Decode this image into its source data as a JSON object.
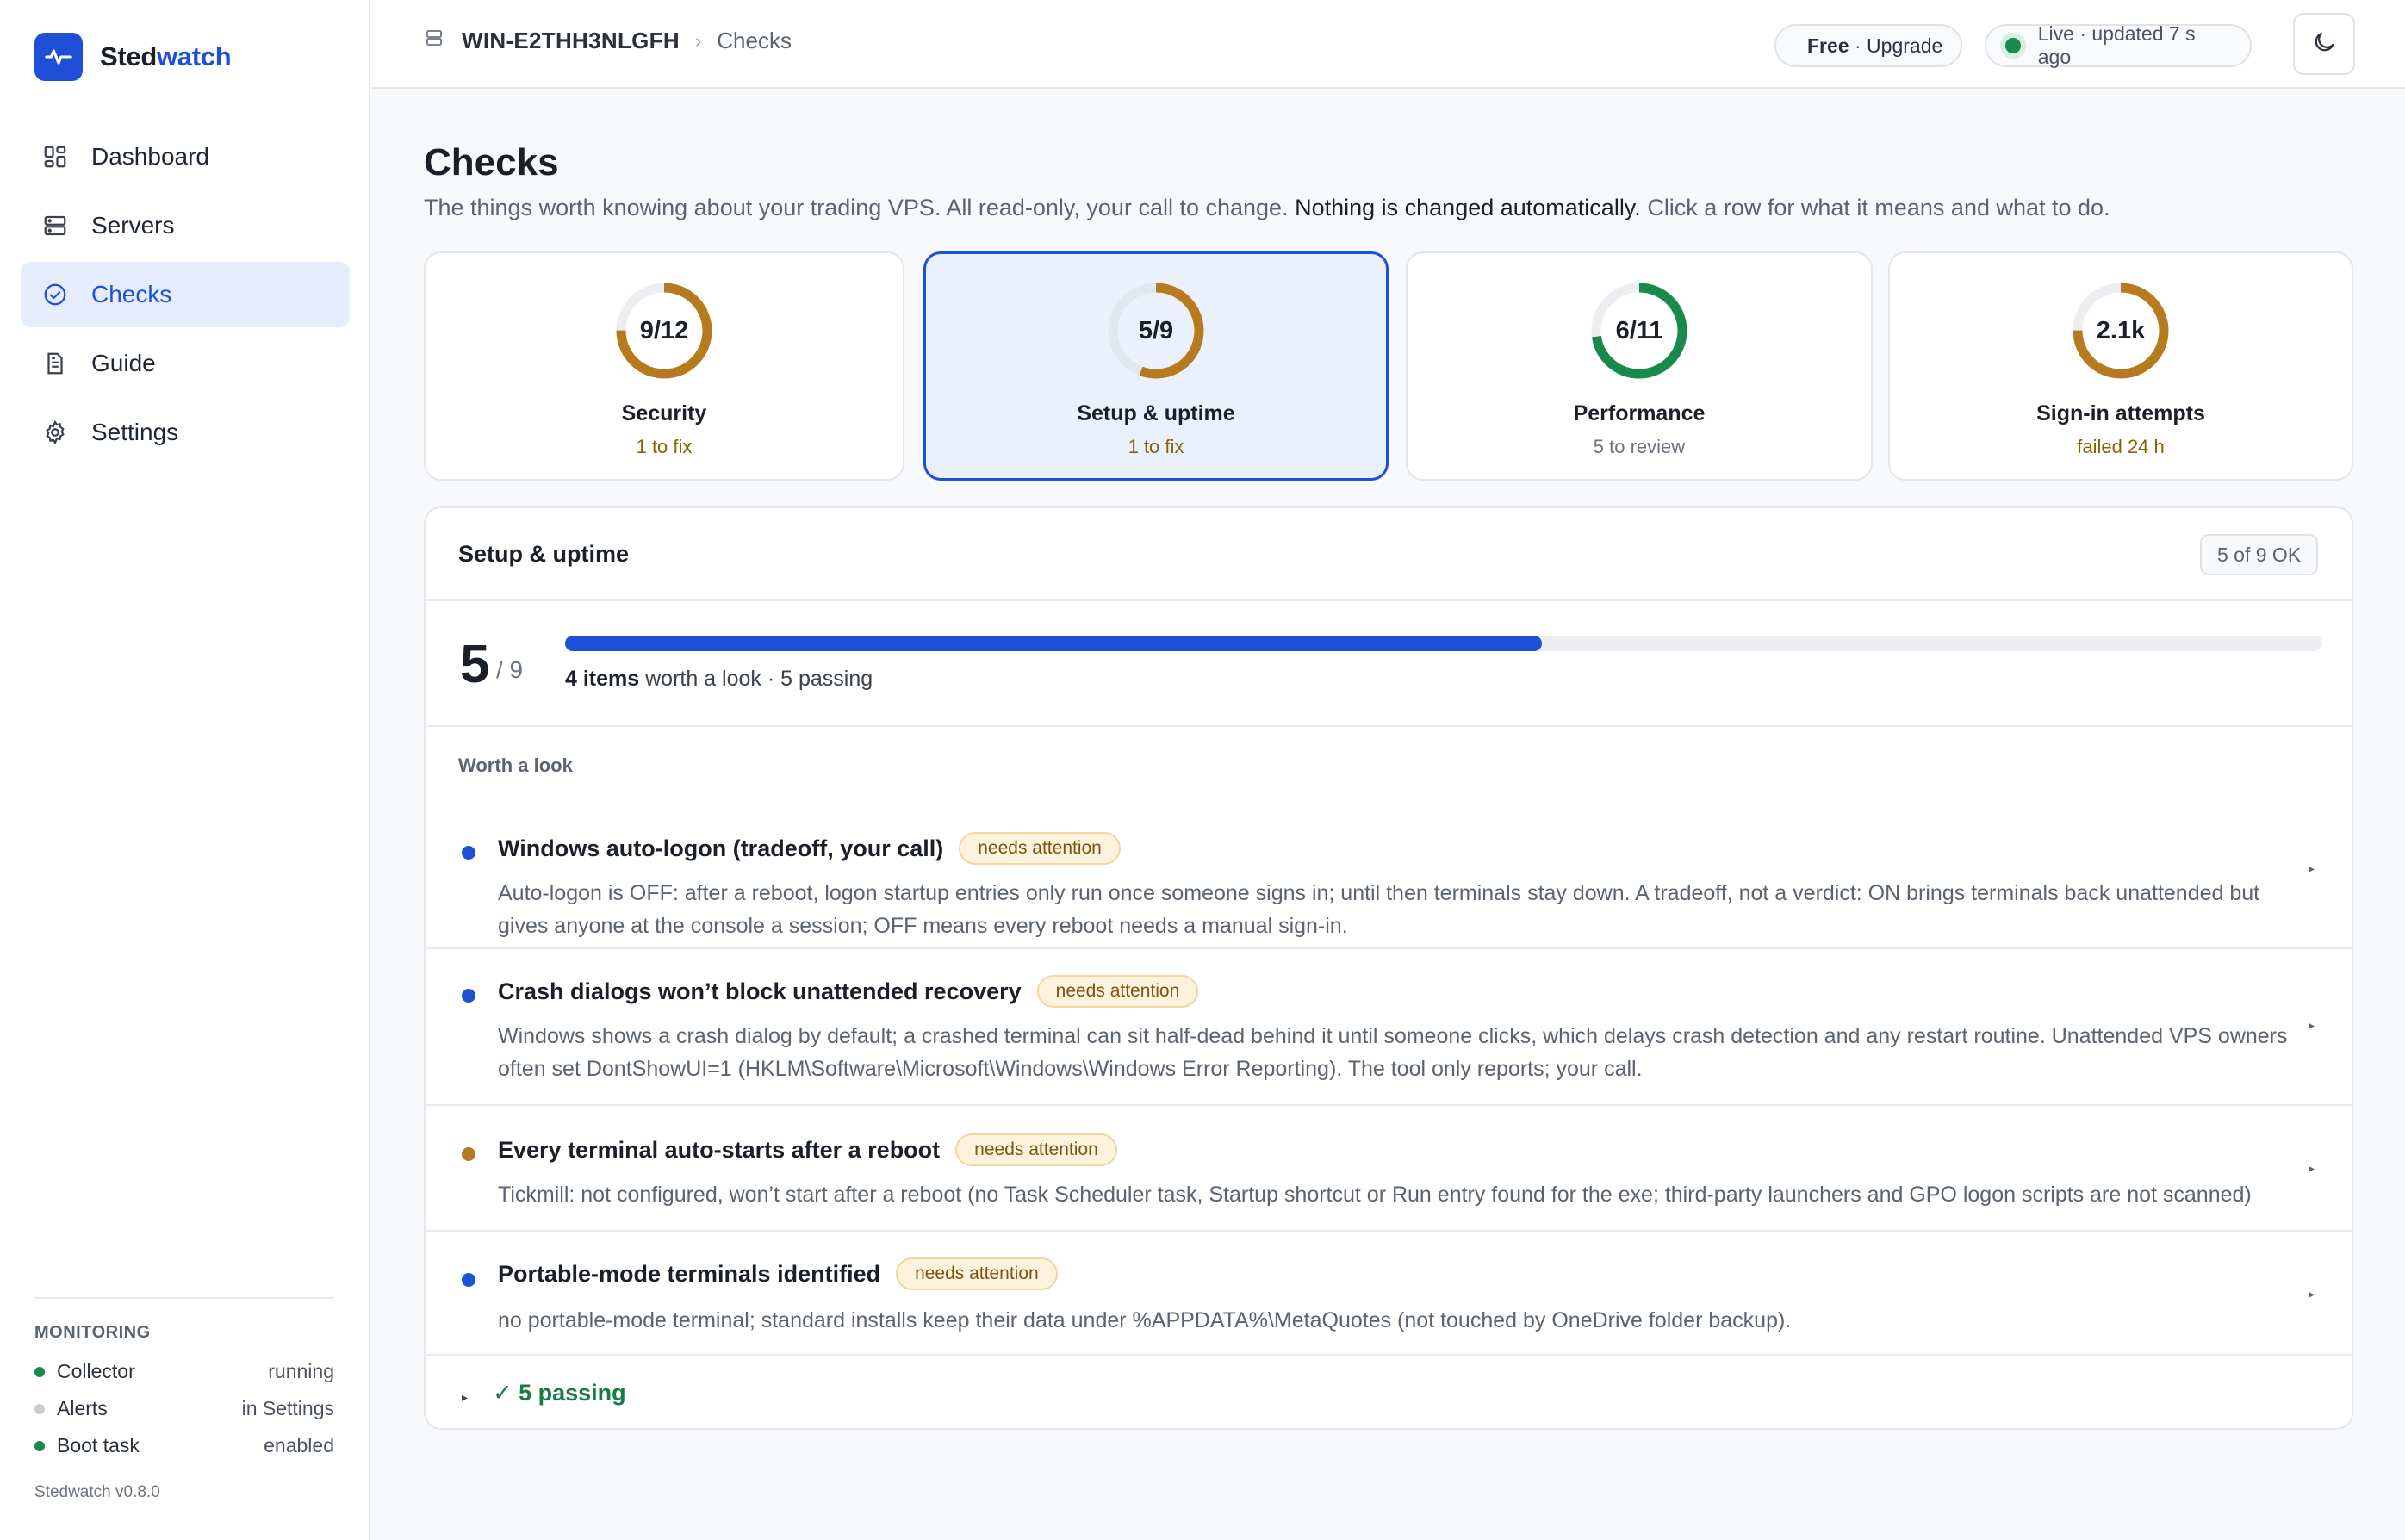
{
  "brand": {
    "name_prefix": "Sted",
    "name_suffix": "watch"
  },
  "sidebar": {
    "items": [
      {
        "label": "Dashboard",
        "icon": "dashboard-icon"
      },
      {
        "label": "Servers",
        "icon": "servers-icon"
      },
      {
        "label": "Checks",
        "icon": "checks-icon",
        "active": true
      },
      {
        "label": "Guide",
        "icon": "guide-icon"
      },
      {
        "label": "Settings",
        "icon": "gear-icon"
      }
    ],
    "monitoring": {
      "title": "MONITORING",
      "rows": [
        {
          "label": "Collector",
          "value": "running",
          "color": "#1a8a4c"
        },
        {
          "label": "Alerts",
          "value": "in Settings",
          "color": "#c9ccd2"
        },
        {
          "label": "Boot task",
          "value": "enabled",
          "color": "#1a8a4c"
        }
      ]
    },
    "version": "Stedwatch v0.8.0"
  },
  "topbar": {
    "server": "WIN-E2THH3NLGFH",
    "separator": "›",
    "current": "Checks",
    "plan_bold": "Free",
    "plan_sep": " · ",
    "plan_link": "Upgrade",
    "live_text": "Live · updated 7 s ago"
  },
  "page": {
    "title": "Checks",
    "subtitle_a": "The things worth knowing about your trading VPS. All read-only, your call to change. ",
    "subtitle_em": "Nothing is changed automatically.",
    "subtitle_b": " Click a row for what it means and what to do."
  },
  "cards": [
    {
      "value": "9/12",
      "label": "Security",
      "sub": "1 to fix",
      "fraction": 0.75,
      "color": "#b87a1e",
      "sub_color": "#8a6100"
    },
    {
      "value": "5/9",
      "label": "Setup & uptime",
      "sub": "1 to fix",
      "fraction": 0.556,
      "color": "#b87a1e",
      "sub_color": "#8a6100",
      "selected": true
    },
    {
      "value": "6/11",
      "label": "Performance",
      "sub": "5 to review",
      "fraction": 0.727,
      "color": "#1a8a4c",
      "sub_color": "#6b7280"
    },
    {
      "value": "2.1k",
      "label": "Sign-in attempts",
      "sub": "failed 24 h",
      "fraction": 0.75,
      "color": "#b87a1e",
      "sub_color": "#8a6100"
    }
  ],
  "panel": {
    "title": "Setup & uptime",
    "badge": "5 of 9 OK",
    "score": "5",
    "score_den": "/ 9",
    "progress": 0.556,
    "summary_bold": "4 items",
    "summary_rest": " worth a look · 5 passing",
    "section": "Worth a look",
    "items": [
      {
        "title": "Windows auto-logon (tradeoff, your call)",
        "tag": "needs attention",
        "dot": "#1f4fd6",
        "desc": "Auto-logon is OFF: after a reboot, logon startup entries only run once someone signs in; until then terminals stay down. A tradeoff, not a verdict: ON brings terminals back unattended but gives anyone at the console a session; OFF means every reboot needs a manual sign-in."
      },
      {
        "title": "Crash dialogs won’t block unattended recovery",
        "tag": "needs attention",
        "dot": "#1f4fd6",
        "desc": "Windows shows a crash dialog by default; a crashed terminal can sit half-dead behind it until someone clicks, which delays crash detection and any restart routine. Unattended VPS owners often set DontShowUI=1 (HKLM\\Software\\Microsoft\\Windows\\Windows Error Reporting). The tool only reports; your call."
      },
      {
        "title": "Every terminal auto-starts after a reboot",
        "tag": "needs attention",
        "dot": "#b87a1e",
        "desc": "Tickmill: not configured, won’t start after a reboot (no Task Scheduler task, Startup shortcut or Run entry found for the exe; third-party launchers and GPO logon scripts are not scanned)"
      },
      {
        "title": "Portable-mode terminals identified",
        "tag": "needs attention",
        "dot": "#1f4fd6",
        "desc": "no portable-mode terminal; standard installs keep their data under %APPDATA%\\MetaQuotes (not touched by OneDrive folder backup)."
      }
    ],
    "passing": "✓ 5 passing"
  }
}
